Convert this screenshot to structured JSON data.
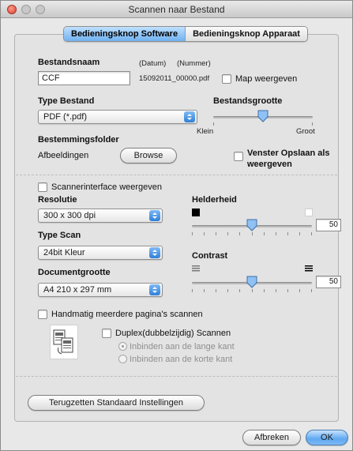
{
  "window": {
    "title": "Scannen naar Bestand"
  },
  "tabs": [
    {
      "label": "Bedieningsknop Software",
      "active": true
    },
    {
      "label": "Bedieningsknop Apparaat",
      "active": false
    }
  ],
  "file": {
    "name_label": "Bestandsnaam",
    "date_token": "(Datum)",
    "number_token": "(Nummer)",
    "name_value": "CCF",
    "example_filename": "15092011_00000.pdf",
    "show_folder_label": "Map weergeven"
  },
  "file_type": {
    "label": "Type Bestand",
    "value": "PDF (*.pdf)"
  },
  "file_size": {
    "label": "Bestandsgrootte",
    "min_label": "Klein",
    "max_label": "Groot",
    "level": 0.5
  },
  "destination": {
    "label": "Bestemmingsfolder",
    "folder_value": "Afbeeldingen",
    "browse_label": "Browse",
    "save_window_label_line1": "Venster Opslaan als",
    "save_window_label_line2": "weergeven"
  },
  "scanner_interface_label": "Scannerinterface weergeven",
  "resolution": {
    "label": "Resolutie",
    "value": "300 x 300 dpi"
  },
  "scan_type": {
    "label": "Type Scan",
    "value": "24bit Kleur"
  },
  "document_size": {
    "label": "Documentgrootte",
    "value": "A4  210 x 297 mm"
  },
  "brightness": {
    "label": "Helderheid",
    "value": "50",
    "level": 0.5
  },
  "contrast": {
    "label": "Contrast",
    "value": "50",
    "level": 0.5
  },
  "multipage_label": "Handmatig meerdere pagina's scannen",
  "duplex": {
    "label": "Duplex(dubbelzijdig) Scannen",
    "option_long": "Inbinden aan de lange kant",
    "option_short": "Inbinden aan de korte kant"
  },
  "reset_button": "Terugzetten Standaard Instellingen",
  "cancel_button": "Afbreken",
  "ok_button": "OK",
  "colors": {
    "accent": "#5fa8f0",
    "tab_active": "#6fb1ef",
    "close": "#d8402e"
  }
}
